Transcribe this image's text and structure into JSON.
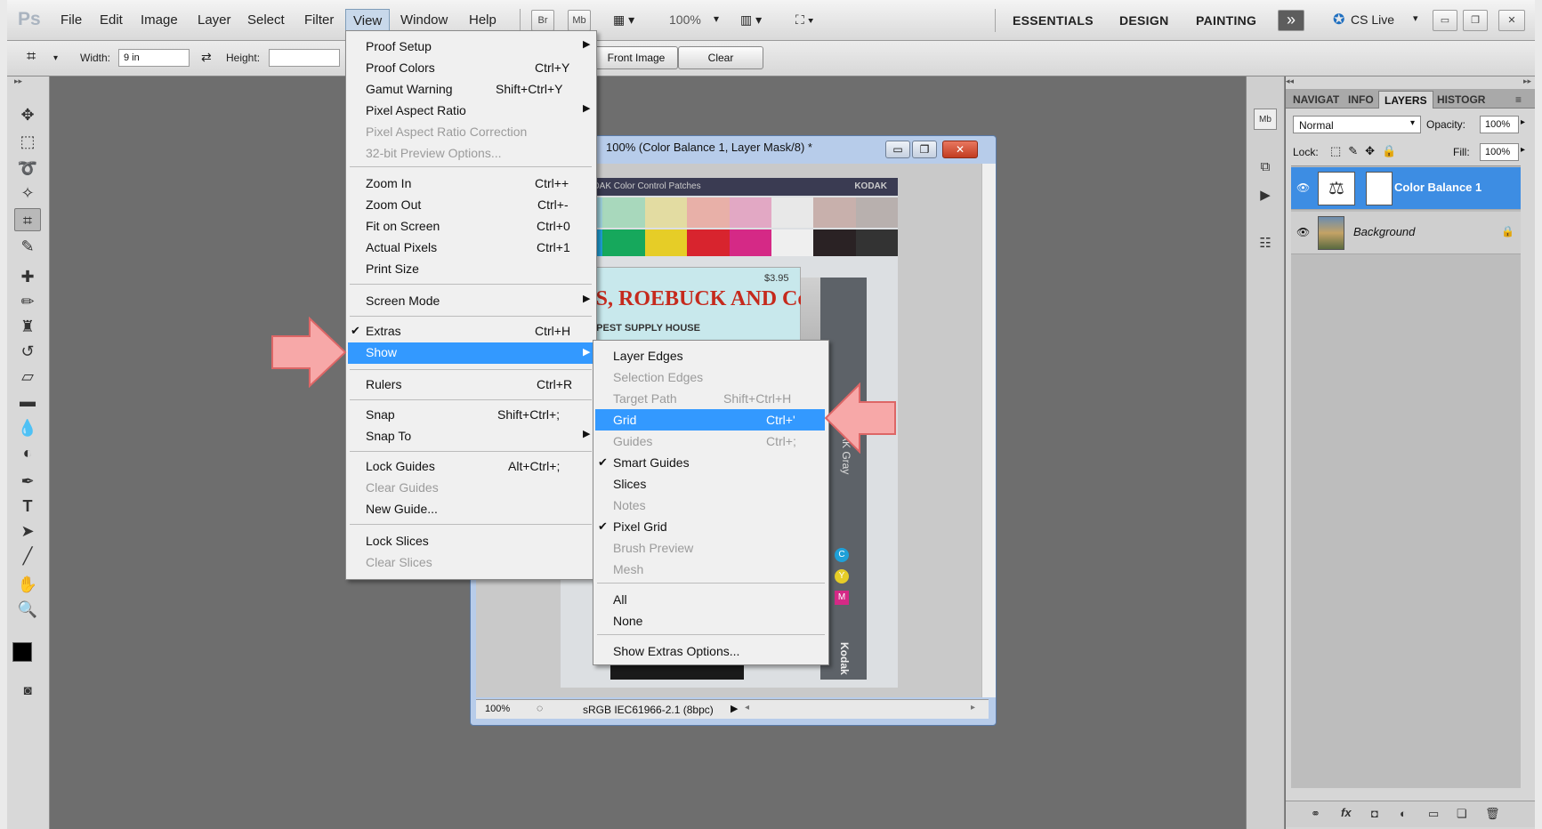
{
  "app": {
    "logo": "Ps"
  },
  "menubar": {
    "items": [
      "File",
      "Edit",
      "Image",
      "Layer",
      "Select",
      "Filter",
      "View",
      "Window",
      "Help"
    ],
    "bridge": "Br",
    "minibridge": "Mb",
    "zoom": "100%",
    "workspaces": [
      "ESSENTIALS",
      "DESIGN",
      "PAINTING"
    ],
    "more": "»",
    "cslive": "CS Live"
  },
  "options": {
    "width_label": "Width:",
    "width_value": "9 in",
    "height_label": "Height:",
    "height_value": "",
    "front_image": "Front Image",
    "clear": "Clear"
  },
  "document": {
    "title": "100% (Color Balance 1, Layer Mask/8) *",
    "zoom": "100%",
    "profile": "sRGB IEC61966-2.1 (8bpc)",
    "photo_header": "KODAK Color Control Patches",
    "photo_brand": "KODAK",
    "photo_label": "ARS, ROEBUCK AND Co.",
    "photo_sub": "CHEAPEST SUPPLY HOUSE",
    "photo_price": "$3.95",
    "photo_gray": "KODAK Gray",
    "photo_kodak": "Kodak",
    "cmy": [
      "C",
      "Y",
      "M"
    ]
  },
  "view_menu": {
    "items": [
      {
        "label": "Proof Setup",
        "shortcut": "",
        "sub": true
      },
      {
        "label": "Proof Colors",
        "shortcut": "Ctrl+Y"
      },
      {
        "label": "Gamut Warning",
        "shortcut": "Shift+Ctrl+Y"
      },
      {
        "label": "Pixel Aspect Ratio",
        "shortcut": "",
        "sub": true
      },
      {
        "label": "Pixel Aspect Ratio Correction",
        "shortcut": "",
        "disabled": true
      },
      {
        "label": "32-bit Preview Options...",
        "shortcut": "",
        "disabled": true
      },
      {
        "label": "Zoom In",
        "shortcut": "Ctrl++"
      },
      {
        "label": "Zoom Out",
        "shortcut": "Ctrl+-"
      },
      {
        "label": "Fit on Screen",
        "shortcut": "Ctrl+0"
      },
      {
        "label": "Actual Pixels",
        "shortcut": "Ctrl+1"
      },
      {
        "label": "Print Size",
        "shortcut": ""
      },
      {
        "label": "Screen Mode",
        "shortcut": "",
        "sub": true
      },
      {
        "label": "Extras",
        "shortcut": "Ctrl+H",
        "checked": true
      },
      {
        "label": "Show",
        "shortcut": "",
        "sub": true,
        "highlight": true
      },
      {
        "label": "Rulers",
        "shortcut": "Ctrl+R"
      },
      {
        "label": "Snap",
        "shortcut": "Shift+Ctrl+;"
      },
      {
        "label": "Snap To",
        "shortcut": "",
        "sub": true
      },
      {
        "label": "Lock Guides",
        "shortcut": "Alt+Ctrl+;"
      },
      {
        "label": "Clear Guides",
        "shortcut": "",
        "disabled": true
      },
      {
        "label": "New Guide...",
        "shortcut": ""
      },
      {
        "label": "Lock Slices",
        "shortcut": ""
      },
      {
        "label": "Clear Slices",
        "shortcut": "",
        "disabled": true
      }
    ]
  },
  "show_menu": {
    "items": [
      {
        "label": "Layer Edges",
        "shortcut": ""
      },
      {
        "label": "Selection Edges",
        "shortcut": "",
        "disabled": true
      },
      {
        "label": "Target Path",
        "shortcut": "Shift+Ctrl+H",
        "disabled": true
      },
      {
        "label": "Grid",
        "shortcut": "Ctrl+'",
        "highlight": true
      },
      {
        "label": "Guides",
        "shortcut": "Ctrl+;",
        "disabled": true
      },
      {
        "label": "Smart Guides",
        "shortcut": "",
        "checked": true
      },
      {
        "label": "Slices",
        "shortcut": ""
      },
      {
        "label": "Notes",
        "shortcut": "",
        "disabled": true
      },
      {
        "label": "Pixel Grid",
        "shortcut": "",
        "checked": true
      },
      {
        "label": "Brush Preview",
        "shortcut": "",
        "disabled": true
      },
      {
        "label": "Mesh",
        "shortcut": "",
        "disabled": true
      },
      {
        "label": "All",
        "shortcut": ""
      },
      {
        "label": "None",
        "shortcut": ""
      },
      {
        "label": "Show Extras Options...",
        "shortcut": ""
      }
    ]
  },
  "layers_panel": {
    "tabs": [
      "NAVIGAT",
      "INFO",
      "LAYERS",
      "HISTOGR"
    ],
    "blend_mode": "Normal",
    "opacity_label": "Opacity:",
    "opacity_value": "100%",
    "lock_label": "Lock:",
    "fill_label": "Fill:",
    "fill_value": "100%",
    "layers": [
      "Color Balance 1",
      "Background"
    ]
  },
  "colors": {
    "highlight": "#3399ff",
    "arrow": "#f7a8a8",
    "layer_selected": "#3d8de3"
  }
}
